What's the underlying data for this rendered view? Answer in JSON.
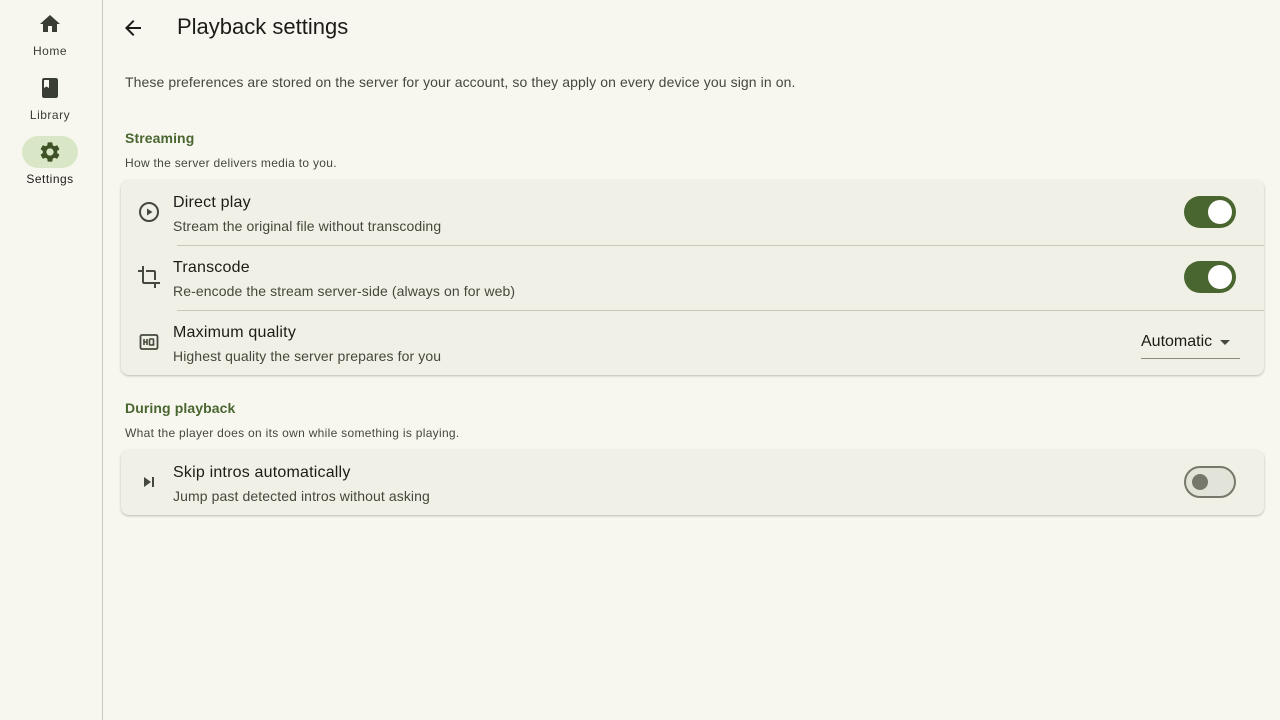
{
  "nav": {
    "items": [
      {
        "label": "Home",
        "icon": "home-icon",
        "active": false
      },
      {
        "label": "Library",
        "icon": "book-icon",
        "active": false
      },
      {
        "label": "Settings",
        "icon": "gear-icon",
        "active": true
      }
    ]
  },
  "header": {
    "title": "Playback settings"
  },
  "intro": "These preferences are stored on the server for your account, so they apply on every device you sign in on.",
  "sections": [
    {
      "title": "Streaming",
      "subtitle": "How the server delivers media to you.",
      "rows": [
        {
          "title": "Direct play",
          "subtitle": "Stream the original file without transcoding",
          "icon": "play-circle-icon",
          "control": "switch",
          "on": true
        },
        {
          "title": "Transcode",
          "subtitle": "Re-encode the stream server-side (always on for web)",
          "icon": "crop-icon",
          "control": "switch",
          "on": true
        },
        {
          "title": "Maximum quality",
          "subtitle": "Highest quality the server prepares for you",
          "icon": "hq-icon",
          "control": "select",
          "value": "Automatic"
        }
      ]
    },
    {
      "title": "During playback",
      "subtitle": "What the player does on its own while something is playing.",
      "rows": [
        {
          "title": "Skip intros automatically",
          "subtitle": "Jump past detected intros without asking",
          "icon": "skip-next-icon",
          "control": "switch",
          "on": false
        }
      ]
    }
  ],
  "colors": {
    "accent": "#4a6630",
    "background": "#f7f7ef",
    "card": "#f0f0e6",
    "active_pill": "#d9e7c6"
  }
}
